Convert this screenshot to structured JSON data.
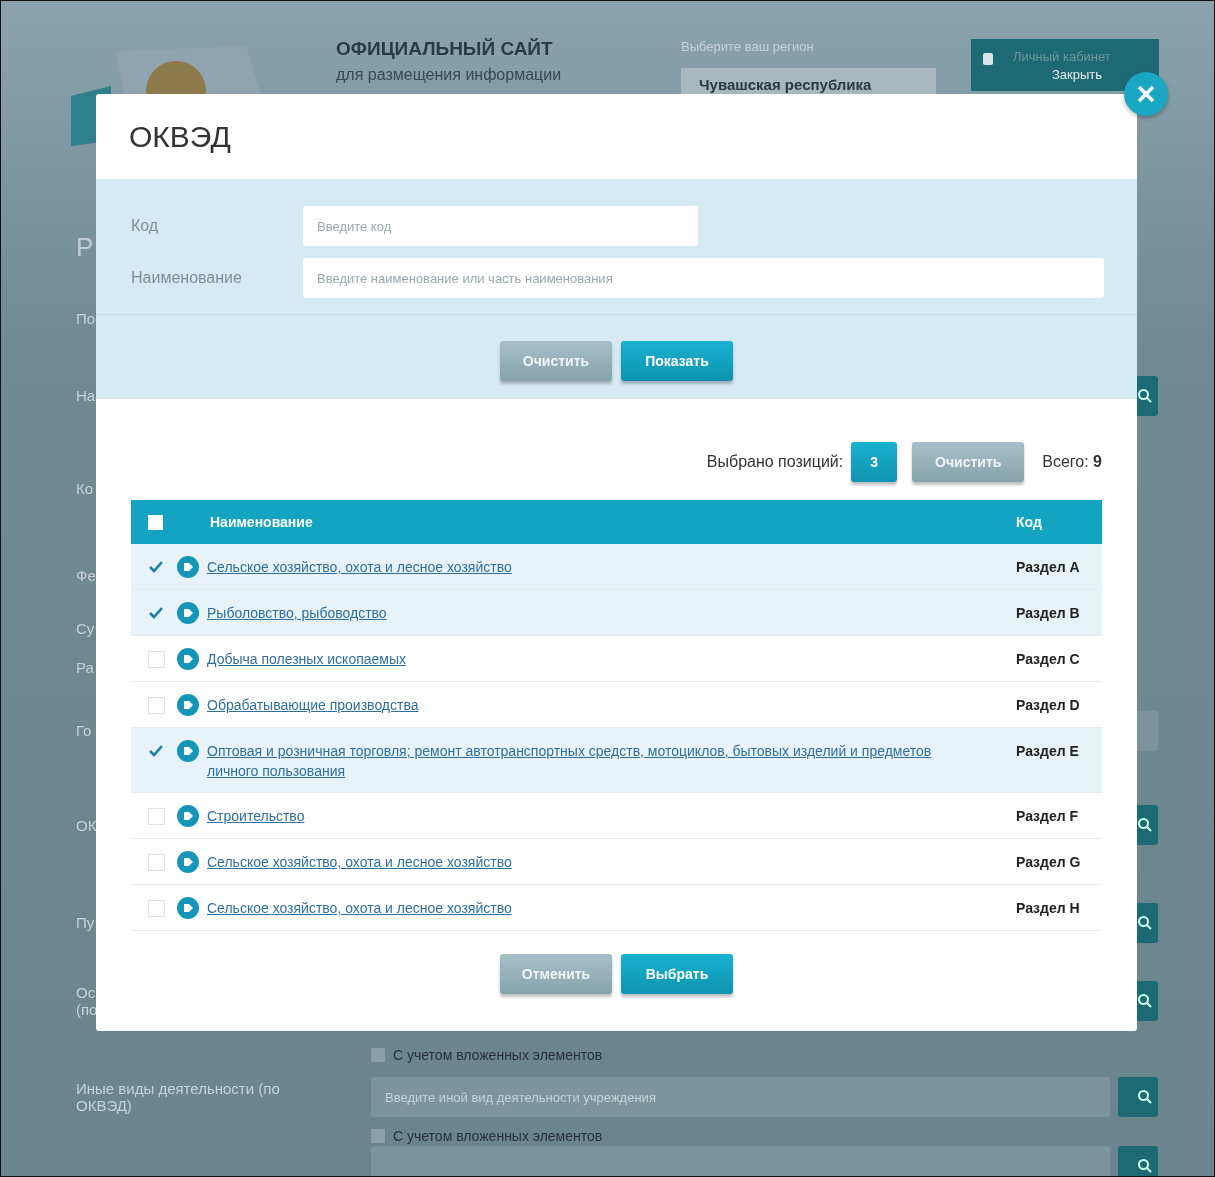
{
  "page": {
    "site_title": "ОФИЦИАЛЬНЫЙ САЙТ",
    "site_subtitle": "для размещения информации",
    "region_label": "Выберите ваш регион",
    "region_value": "Чувашская республика",
    "cabinet_button": "Личный кабинет",
    "cabinet_close": "Закрыть",
    "form_rows": [
      {
        "kind": "title",
        "label": "Р"
      },
      {
        "kind": "text",
        "label": "По"
      },
      {
        "kind": "button",
        "label": "На"
      },
      {
        "kind": "text",
        "label": "Ко"
      },
      {
        "kind": "text",
        "label": "Фе"
      },
      {
        "kind": "text",
        "label": "Су"
      },
      {
        "kind": "text",
        "label": "Ра"
      },
      {
        "kind": "field",
        "label": "Го"
      },
      {
        "kind": "button",
        "label": "ОК"
      },
      {
        "kind": "button",
        "label": "Пу"
      },
      {
        "kind": "button",
        "label": "Ос",
        "label_2": "(по"
      },
      {
        "kind": "checkbox",
        "label": "С учетом вложенных элементов",
        "checked": false
      },
      {
        "kind": "search",
        "label": "Иные виды деятельности (по ОКВЭД)",
        "placeholder": "Введите иной вид деятельности учреждения"
      },
      {
        "kind": "checkbox",
        "label": "С учетом вложенных элементов",
        "checked": false
      },
      {
        "kind": "search"
      }
    ]
  },
  "modal": {
    "title": "ОКВЭД",
    "fields": [
      {
        "label": "Код",
        "placeholder": "Введите код",
        "wide": false
      },
      {
        "label": "Наименование",
        "placeholder": "Введите наименование или часть наименования",
        "wide": true
      }
    ],
    "filter_buttons": [
      {
        "label": "Очистить",
        "kind": "secondary"
      },
      {
        "label": "Показать",
        "kind": "primary"
      }
    ],
    "selected_label": "Выбрано позиций:",
    "selected_count": "3",
    "selected_clear": "Очистить",
    "total": "Всего: **9**",
    "columns": [
      "Наименование",
      "Код"
    ],
    "header_checked": false,
    "rows": [
      {
        "name": "Сельское хозяйство, охота и лесное хозяйство",
        "code": "Раздел A",
        "checked": true
      },
      {
        "name": "Рыболовство, рыбоводство",
        "code": "Раздел B",
        "checked": true
      },
      {
        "name": "Добыча полезных ископаемых",
        "code": "Раздел C",
        "checked": false
      },
      {
        "name": "Обрабатывающие производства",
        "code": "Раздел D",
        "checked": false
      },
      {
        "name": "Оптовая и розничная торговля; ремонт автотранспортных средств, мотоциклов, бытовых изделий и предметов личного пользования",
        "code": "Раздел E",
        "checked": true
      },
      {
        "name": "Строительство",
        "code": "Раздел F",
        "checked": false
      },
      {
        "name": "Сельское хозяйство, охота и лесное хозяйство",
        "code": "Раздел G",
        "checked": false
      },
      {
        "name": "Сельское хозяйство, охота и лесное хозяйство",
        "code": "Раздел H",
        "checked": false
      }
    ],
    "footer_buttons": [
      {
        "label": "Отменить",
        "kind": "secondary"
      },
      {
        "label": "Выбрать",
        "kind": "primary"
      }
    ]
  }
}
